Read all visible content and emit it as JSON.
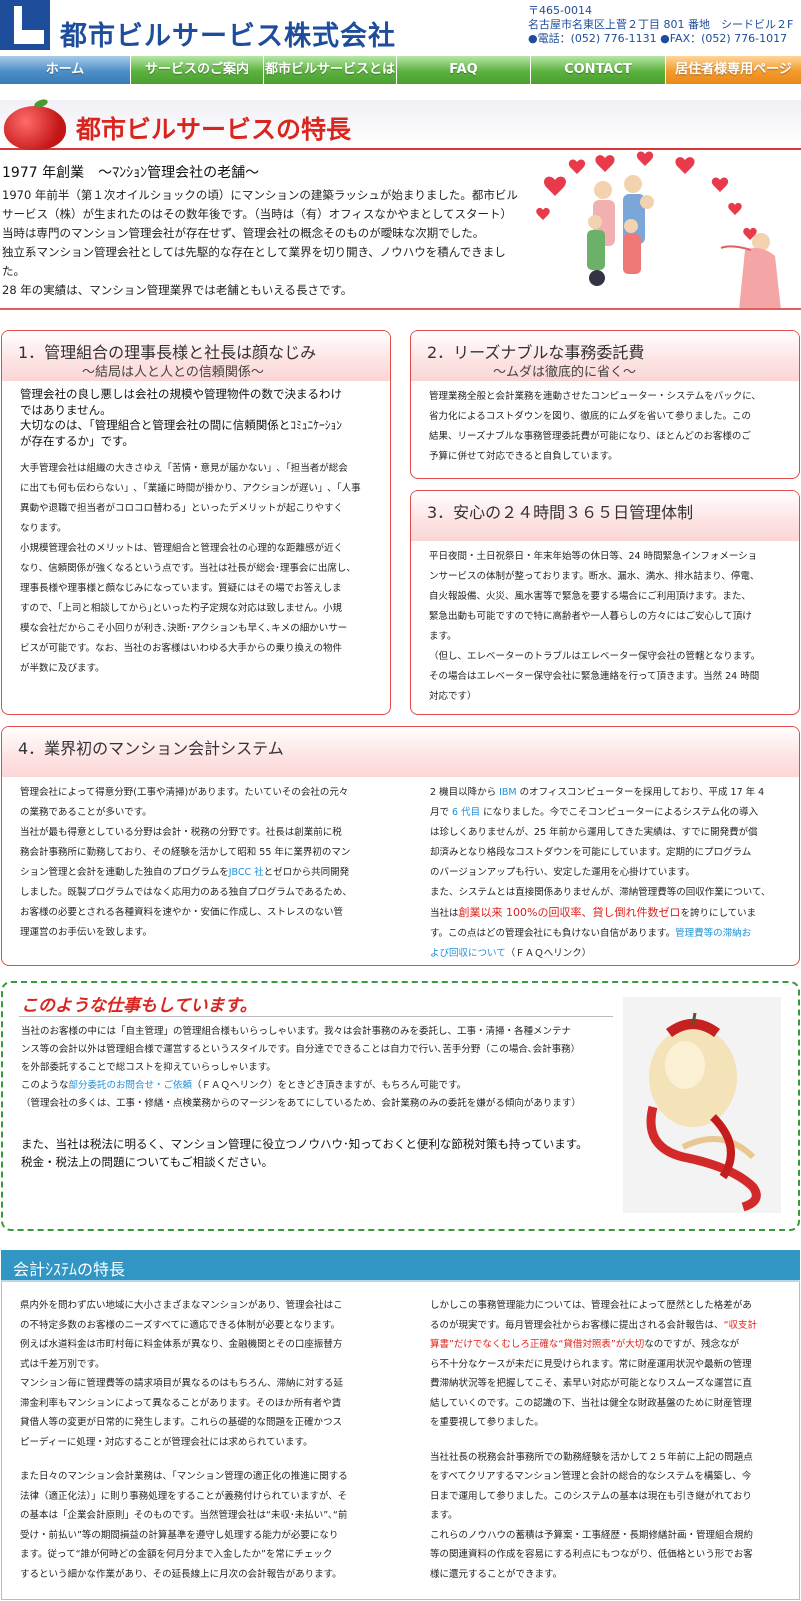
{
  "header": {
    "company_name": "都市ビルサービス株式会社",
    "postal": "〒465-0014",
    "address": "名古屋市名東区上菅２丁目 801 番地　シードビル２F",
    "contact": "●電話：(052) 776-1131 ●FAX：(052) 776-1017"
  },
  "nav": {
    "items": [
      {
        "label": "ホーム"
      },
      {
        "label": "サービスのご案内"
      },
      {
        "label": "都市ビルサービスとは"
      },
      {
        "label": "FAQ"
      },
      {
        "label": "CONTACT"
      },
      {
        "label": "居住者様専用ページ"
      }
    ]
  },
  "features": {
    "title": "都市ビルサービスの特長"
  },
  "intro": {
    "heading": "1977 年創業　～ﾏﾝｼｮﾝ管理会社の老舗～",
    "lines": [
      "1970 年前半（第１次オイルショックの頃）にマンションの建築ラッシュが始まりました。都市ビル",
      "サービス（株）が生まれたのはその数年後です。（当時は（有）オフィスなかやまとしてスタート）",
      "当時は専門のマンション管理会社が存在せず、管理会社の概念そのものが曖昧な次期でした。",
      "独立系マンション管理会社としては先駆的な存在として業界を切り開き、ノウハウを積んできまし",
      "た。",
      "28 年の実績は、マンション管理業界では老舗ともいえる長さです。"
    ]
  },
  "box1": {
    "title": "1．管理組合の理事長様と社長は顔なじみ",
    "subtitle": "～結局は人と人との信頼関係～",
    "lead": [
      "管理会社の良し悪しは会社の規模や管理物件の数で決まるわけ",
      "ではありません。",
      "大切なのは、「管理組合と管理会社の間に信頼関係とｺﾐｭﾆｹｰｼｮﾝ",
      "が存在するか」です。"
    ],
    "body": [
      "大手管理会社は組織の大きさゆえ「苦情・意見が届かない」､「担当者が総会",
      "に出ても何も伝わらない」､「業議に時間が掛かり、アクションが遅い」､「人事",
      "異動や退職で担当者がコロコロ替わる」といったデメリットが起こりやすく",
      "なります。",
      "小規模管理会社のメリットは、管理組合と管理会社の心理的な距離感が近く",
      "なり、信頼関係が強くなるという点です。当社は社長が総会･理事会に出席し、",
      "理事長様や理事様と顔なじみになっています。質疑にはその場でお答えしま",
      "すので、｢上司と相談してから｣といった杓子定規な対応は致しません。小規",
      "模な会社だからこそ小回りが利き､決断･アクションも早く､キメの細かいサー",
      "ビスが可能です。なお、当社のお客様はいわゆる大手からの乗り換えの物件",
      "が半数に及びます。"
    ]
  },
  "box2": {
    "title": "2．リーズナブルな事務委託費",
    "subtitle": "～ムダは徹底的に省く～",
    "body": [
      "管理業務全般と会計業務を連動させたコンピューター・システムをバックに、",
      "省力化によるコストダウンを図り、徹底的にムダを省いて参りました。この",
      "結果、リーズナブルな事務管理委託費が可能になり、ほとんどのお客様のご",
      "予算に併せて対応できると自負しています。"
    ]
  },
  "box3": {
    "title": "3．安心の２４時間３６５日管理体制",
    "body": [
      "平日夜間・土日祝祭日・年末年始等の休日等、24 時間緊急インフォメーショ",
      "ンサービスの体制が整っております。断水、漏水、満水、排水詰まり、停電、",
      "自火報設備、火災、風水害等で緊急を要する場合にご利用頂けます。また、",
      "緊急出動も可能ですので特に高齢者や一人暮らしの方々にはご安心して頂け",
      "ます。",
      "（但し、エレベーターのトラブルはエレベーター保守会社の管轄となります。",
      "その場合はエレベーター保守会社に緊急連絡を行って頂きます。当然 24 時間",
      "対応です）"
    ]
  },
  "box4": {
    "title": "4．業界初のマンション会計システム",
    "left": [
      "管理会社によって得意分野(工事や清掃)があります。たいていその会社の元々",
      "の業務であることが多いです。",
      "当社が最も得意としている分野は会計・税務の分野です。社長は創業前に税",
      "務会計事務所に勤務しており、その経験を活かして昭和 55 年に業界初のマン",
      "ション管理と会計を連動した独自のプログラムを",
      "とゼロから共同開発",
      "しました。既製プログラムではなく応用力のある独自プログラムであるため、",
      "お客様の必要とされる各種資料を速やか・安価に作成し、ストレスのない管",
      "理運営のお手伝いを致します。"
    ],
    "jbcc_link": "JBCC 社",
    "right_a1": "2 機目以降から",
    "ibm_link": "IBM",
    "right_a2": "のオフィスコンピューターを採用しており、平成 17 年 4",
    "right_b1": "月で",
    "gen_link": "6 代目",
    "right_b2": "になりました。今でこそコンピューターによるシステム化の導入",
    "right": [
      "は珍しくありませんが、25 年前から運用してきた実績は、すでに開発費が償",
      "却済みとなり格段なコストダウンを可能にしています。定期的にプログラム",
      "のバージョンアップも行い、安定した運用を心掛けています。",
      "また、システムとは直接関係ありませんが、滞納管理費等の回収作業について、"
    ],
    "right_c1": "当社は",
    "red_text": "創業以来 100%の回収率、貸し倒れ件数ゼロ",
    "right_c2": "を誇りにしていま",
    "right_d1": "す。この点はどの管理会社にも負けない自信があります。",
    "faq_link1": "管理費等の滞納お",
    "faq_link2": "よび回収について",
    "right_e2": "（ＦＡＱへリンク）"
  },
  "work": {
    "title": "このような仕事もしています。",
    "lines": [
      "当社のお客様の中には「自主管理」の管理組合様もいらっしゃいます。我々は会計事務のみを委託し、工事・清掃・各種メンテナ",
      "ンス等の会計以外は管理組合様で運営するというスタイルです。自分達でできることは自力で行い､苦手分野（この場合､会計事務）",
      "を外部委託することで総コストを抑えていらっしゃいます。"
    ],
    "line4_a": "このような",
    "line4_link": "部分委託のお問合せ・ご依頼",
    "line4_b": "（ＦＡＱへリンク）をときどき頂きますが、もちろん可能です。",
    "line5": "（管理会社の多くは、工事・修繕・点検業務からのマージンをあてにしているため、会計業務のみの委託を嫌がる傾向があります）",
    "lines2": [
      "また、当社は税法に明るく、マンション管理に役立つノウハウ･知っておくと便利な節税対策も持っています。",
      "税金・税法上の問題についてもご相談ください。"
    ]
  },
  "accounting": {
    "title": "会計ｼｽﾃﾑの特長",
    "left": [
      "県内外を問わず広い地域に大小さまざまなマンションがあり、管理会社はこ",
      "の不特定多数のお客様のニーズすべてに適応できる体制が必要となります。",
      "例えば水道料金は市町村毎に料金体系が異なり、金融機関とその口座振替方",
      "式は千差万別です。",
      "マンション毎に管理費等の請求項目が異なるのはもちろん、滞納に対する延",
      "滞金利率もマンションによって異なることがあります。そのほか所有者や賃",
      "貸借人等の変更が日常的に発生します。これらの基礎的な問題を正確かつス",
      "ピーディーに処理・対応することが管理会社には求められています。",
      "",
      "また日々のマンション会計業務は、「マンション管理の適正化の推進に関する",
      "法律（適正化法）」に則り事務処理をすることが義務付けられていますが、そ",
      "の基本は「企業会計原則」そのものです。当然管理会社は“未収･未払い”､“前",
      "受け・前払い”等の期間損益の計算基準を遵守し処理する能力が必要になり",
      "ます。従って“誰が何時どの金額を何月分まで入金したか”を常にチェック",
      "するという細かな作業があり、その延長線上に月次の会計報告があります。"
    ],
    "right_a": [
      "しかしこの事務管理能力については、管理会社によって歴然とした格差があ",
      "るのが現実です。毎月管理会社からお客様に提出される会計報告は、"
    ],
    "right_red1": "“収支計",
    "right_red2": "算書”だけでなくむしろ正確な“貸借対照表”が大切",
    "right_b1": "なのですが、残念なが",
    "right_b": [
      "ら不十分なケースが未だに見受けられます。常に財産運用状況や最新の管理",
      "費滞納状況等を把握してこそ、素早い対応が可能となりスムーズな運営に直",
      "結していくのです。この認識の下、当社は健全な財政基盤のために財産管理",
      "を重要視して参りました。",
      "",
      "当社社長の税務会計事務所での勤務経験を活かして２５年前に上記の問題点",
      "をすべてクリアするマンション管理と会計の総合的なシステムを構築し、今",
      "日まで運用して参りました。このシステムの基本は現在も引き継がれており",
      "ます。",
      "これらのノウハウの蓄積は予算案・工事経歴・長期修繕計画・管理組合規約",
      "等の関連資料の作成を容易にする利点にもつながり、低価格という形でお客",
      "様に還元することができます。"
    ]
  }
}
